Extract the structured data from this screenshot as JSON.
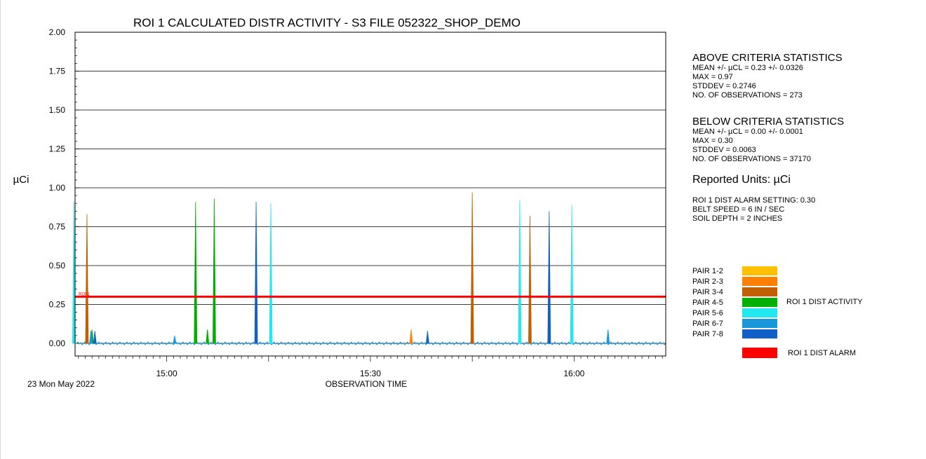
{
  "chart_data": {
    "type": "line",
    "title": "ROI 1 CALCULATED DISTR ACTIVITY - S3 FILE 052322_SHOP_DEMO",
    "ylabel": "µCi",
    "xlabel": "OBSERVATION TIME",
    "date_label": "23 Mon  May 2022",
    "ylim": [
      0.0,
      2.0
    ],
    "y_ticks": [
      "0.00",
      "0.25",
      "0.50",
      "0.75",
      "1.00",
      "1.25",
      "1.50",
      "1.75",
      "2.00"
    ],
    "x_range_minutes": [
      "14:45",
      "16:15"
    ],
    "x_ticks": [
      {
        "time": "15:00",
        "label": "15:00"
      },
      {
        "time": "15:30",
        "label": "15:30"
      },
      {
        "time": "16:00",
        "label": "16:00"
      }
    ],
    "baseline_value": 0.0,
    "alarm": {
      "name": "ROI 1 DIST ALARM",
      "value": 0.3,
      "color": "#ff0000",
      "marker_text": "ROI 1"
    },
    "series": [
      {
        "name": "PAIR 1-2",
        "color": "#ffc000",
        "peaks": []
      },
      {
        "name": "PAIR 2-3",
        "color": "#ff8000",
        "peaks": [
          {
            "t": "15:36:00",
            "v": 0.09
          }
        ]
      },
      {
        "name": "PAIR 3-4",
        "color": "#c06000",
        "peaks": [
          {
            "t": "14:48:15",
            "v": 0.83
          },
          {
            "t": "15:45:00",
            "v": 0.97
          },
          {
            "t": "15:53:30",
            "v": 0.82
          }
        ]
      },
      {
        "name": "PAIR 4-5",
        "color": "#00b000",
        "peaks": [
          {
            "t": "14:49:00",
            "v": 0.09
          },
          {
            "t": "15:04:15",
            "v": 0.91
          },
          {
            "t": "15:06:00",
            "v": 0.09
          },
          {
            "t": "15:07:00",
            "v": 0.93
          }
        ]
      },
      {
        "name": "PAIR 5-6",
        "color": "#22e8f0",
        "peaks": [
          {
            "t": "14:46:20",
            "v": 0.91
          },
          {
            "t": "15:15:20",
            "v": 0.9
          },
          {
            "t": "15:52:00",
            "v": 0.92
          },
          {
            "t": "15:59:40",
            "v": 0.89
          }
        ]
      },
      {
        "name": "PAIR 6-7",
        "color": "#1898d8",
        "peaks": [
          {
            "t": "14:48:50",
            "v": 0.08
          },
          {
            "t": "15:01:10",
            "v": 0.05
          },
          {
            "t": "16:05:00",
            "v": 0.09
          }
        ]
      },
      {
        "name": "PAIR 7-8",
        "color": "#1060c8",
        "peaks": [
          {
            "t": "14:49:25",
            "v": 0.08
          },
          {
            "t": "15:13:10",
            "v": 0.91
          },
          {
            "t": "15:38:25",
            "v": 0.08
          },
          {
            "t": "15:56:20",
            "v": 0.85
          }
        ]
      }
    ]
  },
  "above": {
    "title": "ABOVE CRITERIA STATISTICS",
    "mean": "MEAN +/- µCL = 0.23 +/- 0.0326",
    "max": "MAX = 0.97",
    "stddev": "STDDEV = 0.2746",
    "obs": "NO. OF OBSERVATIONS = 273"
  },
  "below": {
    "title": "BELOW CRITERIA STATISTICS",
    "mean": "MEAN +/- µCL = 0.00 +/- 0.0001",
    "max": "MAX = 0.30",
    "stddev": "STDDEV = 0.0063",
    "obs": "NO. OF OBSERVATIONS = 37170"
  },
  "units": "Reported Units: µCi",
  "settings": {
    "alarm": "ROI 1 DIST ALARM SETTING: 0.30",
    "belt": "BELT SPEED = 6 IN / SEC",
    "soil": "SOIL DEPTH  = 2 INCHES"
  },
  "legend": {
    "items": [
      {
        "label": "PAIR 1-2",
        "color": "#ffc000"
      },
      {
        "label": "PAIR 2-3",
        "color": "#ff8000"
      },
      {
        "label": "PAIR 3-4",
        "color": "#c06000"
      },
      {
        "label": "PAIR 4-5",
        "color": "#00b000"
      },
      {
        "label": "PAIR 5-6",
        "color": "#22e8f0"
      },
      {
        "label": "PAIR 6-7",
        "color": "#1898d8"
      },
      {
        "label": "PAIR 7-8",
        "color": "#1060c8"
      }
    ],
    "group_label": "ROI 1 DIST ACTIVITY",
    "alarm_label": "ROI 1 DIST ALARM",
    "alarm_color": "#ff0000"
  }
}
